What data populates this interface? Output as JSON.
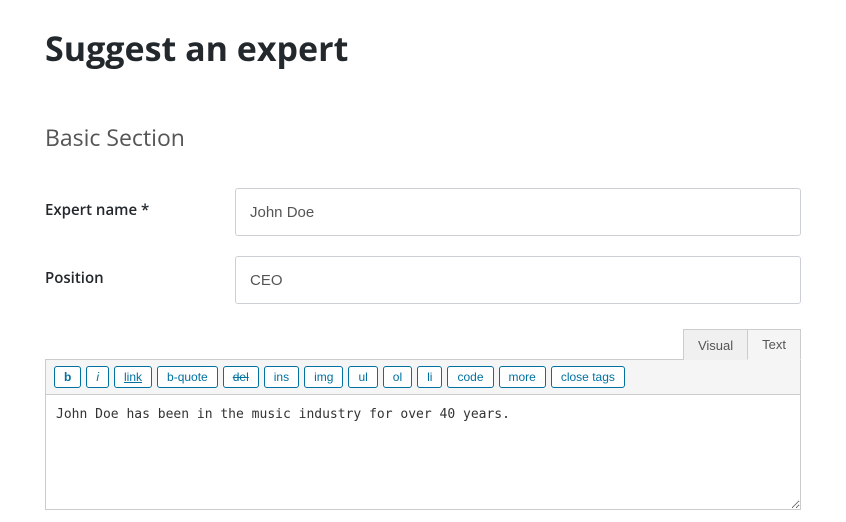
{
  "page_title": "Suggest an expert",
  "section_title": "Basic Section",
  "fields": {
    "expert_name": {
      "label": "Expert name *",
      "value": "John Doe"
    },
    "position": {
      "label": "Position",
      "value": "CEO"
    }
  },
  "editor": {
    "tabs": {
      "visual": "Visual",
      "text": "Text"
    },
    "toolbar": {
      "b": "b",
      "i": "i",
      "link": "link",
      "bquote": "b-quote",
      "del": "del",
      "ins": "ins",
      "img": "img",
      "ul": "ul",
      "ol": "ol",
      "li": "li",
      "code": "code",
      "more": "more",
      "close": "close tags"
    },
    "content": "John Doe has been in the music industry for over 40 years."
  }
}
